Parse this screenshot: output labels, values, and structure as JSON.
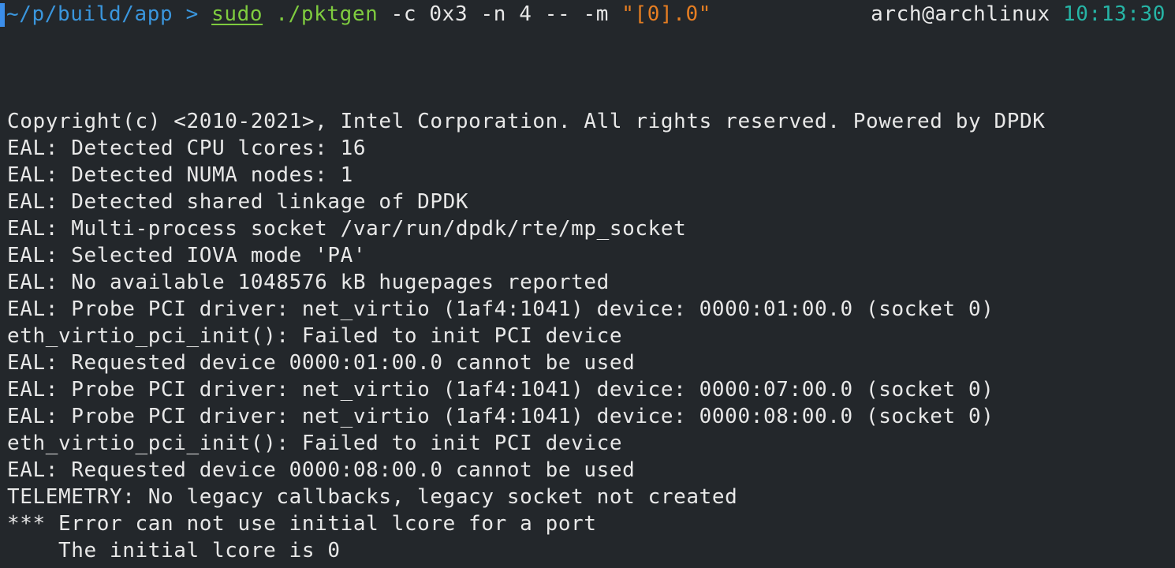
{
  "prompt": {
    "path": "~/p/build/app",
    "arrow": ">",
    "sudo": "sudo",
    "executable": "./pktgen",
    "args": "-c 0x3 -n 4 -- -m",
    "quote_open": "\"",
    "string_arg": "[0].0",
    "quote_close": "\"",
    "user_host": "arch@archlinux",
    "time": "10:13:30"
  },
  "output_lines": [
    "Copyright(c) <2010-2021>, Intel Corporation. All rights reserved. Powered by DPDK",
    "EAL: Detected CPU lcores: 16",
    "EAL: Detected NUMA nodes: 1",
    "EAL: Detected shared linkage of DPDK",
    "EAL: Multi-process socket /var/run/dpdk/rte/mp_socket",
    "EAL: Selected IOVA mode 'PA'",
    "EAL: No available 1048576 kB hugepages reported",
    "EAL: Probe PCI driver: net_virtio (1af4:1041) device: 0000:01:00.0 (socket 0)",
    "eth_virtio_pci_init(): Failed to init PCI device",
    "EAL: Requested device 0000:01:00.0 cannot be used",
    "EAL: Probe PCI driver: net_virtio (1af4:1041) device: 0000:07:00.0 (socket 0)",
    "EAL: Probe PCI driver: net_virtio (1af4:1041) device: 0000:08:00.0 (socket 0)",
    "eth_virtio_pci_init(): Failed to init PCI device",
    "EAL: Requested device 0000:08:00.0 cannot be used",
    "TELEMETRY: No legacy callbacks, legacy socket not created",
    "*** Error can not use initial lcore for a port",
    "    The initial lcore is 0"
  ]
}
